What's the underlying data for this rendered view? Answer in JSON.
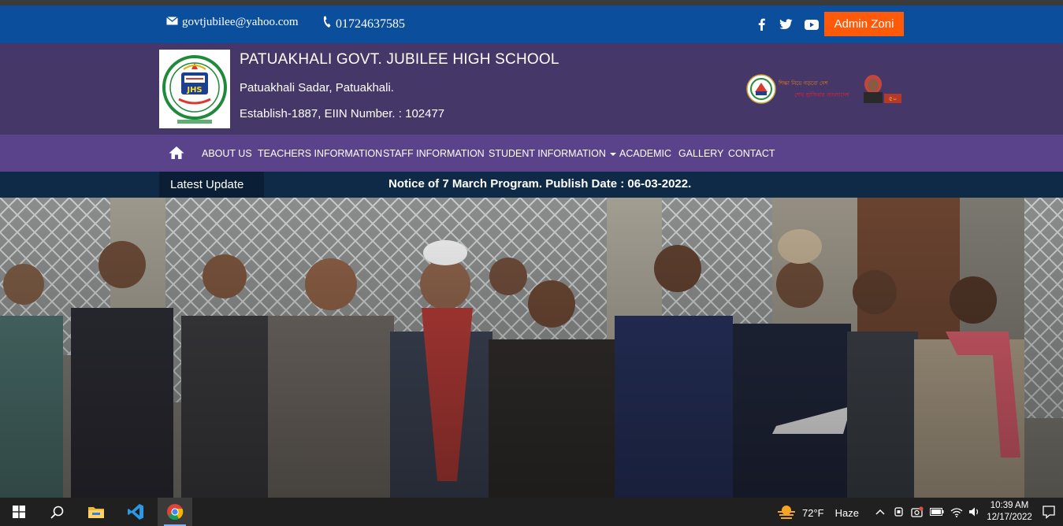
{
  "topbar": {
    "email": "govtjubilee@yahoo.com",
    "phone": "01724637585",
    "social_icons": [
      "facebook-icon",
      "twitter-icon",
      "youtube-icon"
    ],
    "admin_button": "Admin Zoni",
    "bg_color": "#0b4f9c",
    "accent_color": "#ff5a0a"
  },
  "header": {
    "title": "PATUAKHALI GOVT. JUBILEE HIGH SCHOOL",
    "address": "Patuakhali Sadar, Patuakhali.",
    "establish": "Establish-1887, EIIN Number. : 102477",
    "logo_text": "JHS",
    "logo_ring_text": "পটুয়াখালী সরকারি জুবিলী উচ্চ বিদ্যালয়",
    "logo_year": "স্থাপিত-১৮৮৭ইং",
    "banner_text_1": "শেখ হাসিনার বাংলাদেশ",
    "bg_color": "#463769"
  },
  "nav": {
    "items": [
      {
        "label": "ABOUT US"
      },
      {
        "label": "TEACHERS INFORMATION"
      },
      {
        "label": "STAFF INFORMATION"
      },
      {
        "label": "STUDENT INFORMATION"
      },
      {
        "label": "ACADEMIC"
      },
      {
        "label": "GALLERY"
      },
      {
        "label": "CONTACT"
      }
    ],
    "bg_color": "#5a438a"
  },
  "ticker": {
    "label": "Latest Update",
    "notice": "Notice of 7 March Program. Publish Date : 06-03-2022."
  },
  "taskbar": {
    "pinned": [
      "windows-start-icon",
      "search-icon",
      "file-explorer-icon",
      "vscode-icon",
      "chrome-icon"
    ],
    "weather_temp": "72°F",
    "weather_desc": "Haze",
    "time": "10:39 AM",
    "date": "12/17/2022"
  }
}
